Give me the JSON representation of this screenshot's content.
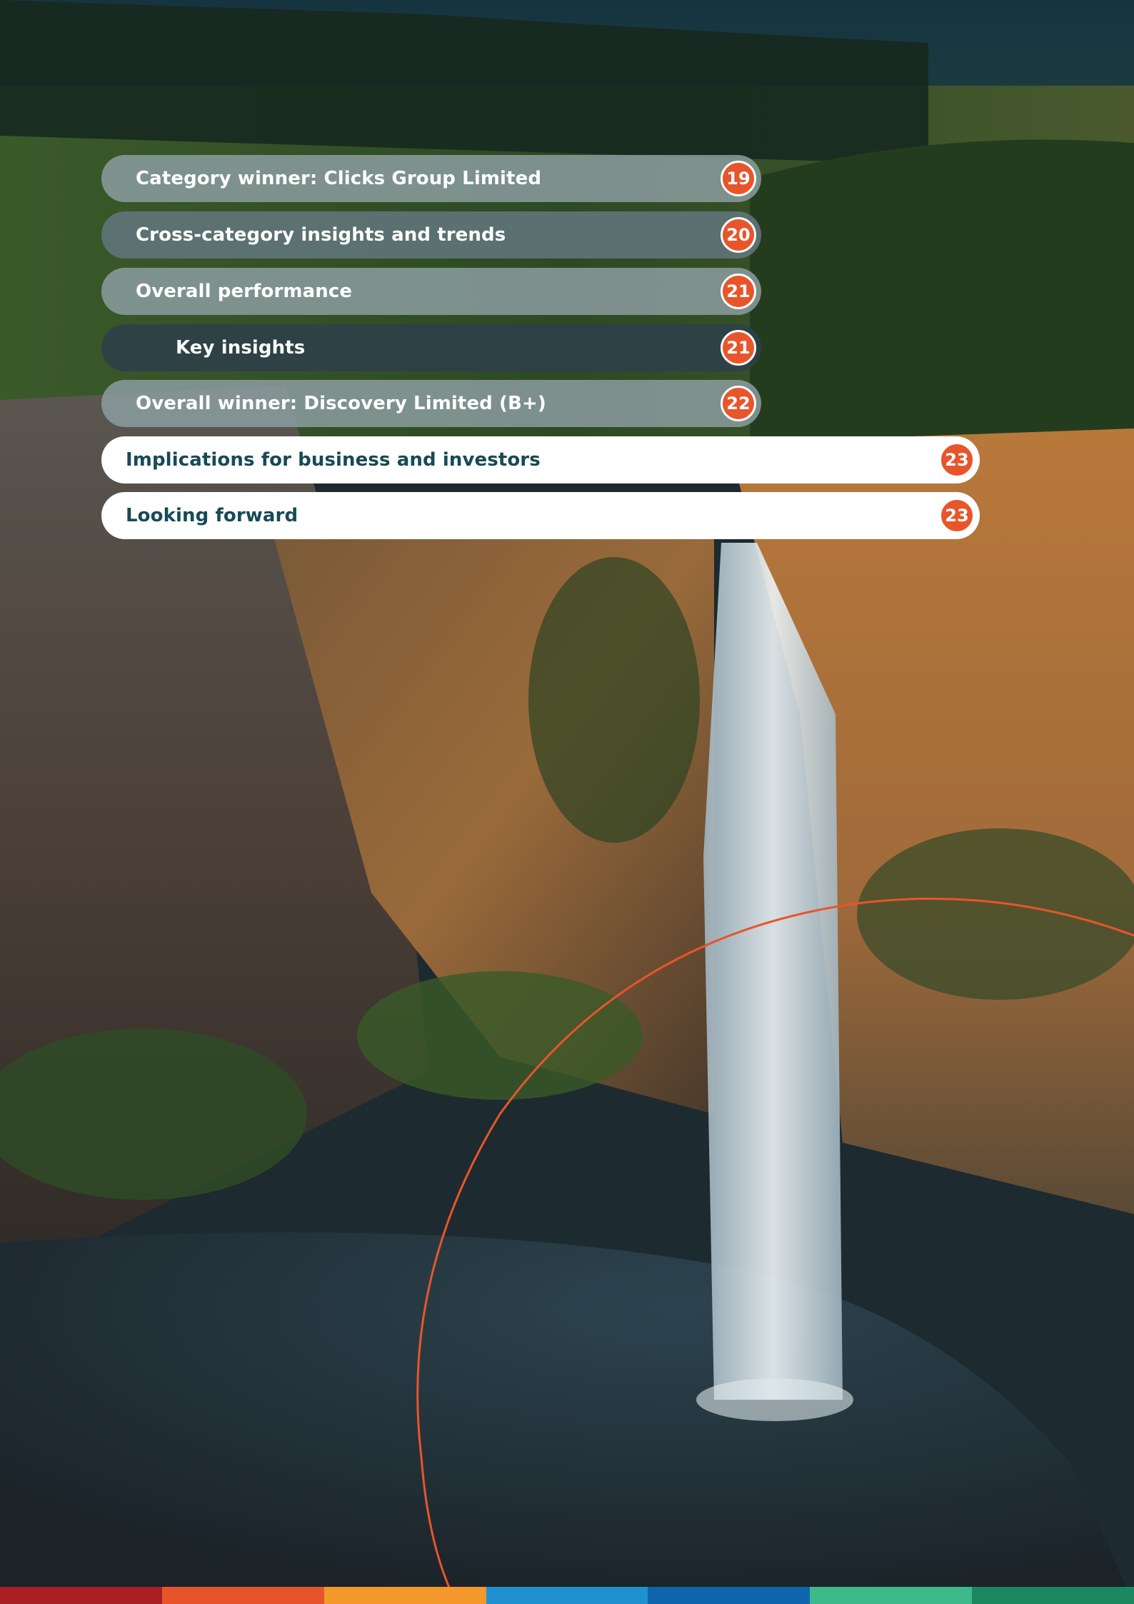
{
  "toc": {
    "entries": [
      {
        "label": "Category winner: Clicks Group Limited",
        "page": "19",
        "level": "sub"
      },
      {
        "label": "Cross-category insights and trends",
        "page": "20",
        "level": "sub"
      },
      {
        "label": "Overall performance",
        "page": "21",
        "level": "sub"
      },
      {
        "label": "Key insights",
        "page": "21",
        "level": "subsub"
      },
      {
        "label": "Overall winner: Discovery Limited (B+)",
        "page": "22",
        "level": "sub"
      },
      {
        "label": "Implications for business and investors",
        "page": "23",
        "level": "main"
      },
      {
        "label": "Looking forward",
        "page": "23",
        "level": "main"
      }
    ]
  },
  "colors": {
    "accent_orange": "#e8552a",
    "heading_teal": "#174a55",
    "stripe": [
      "#a81e22",
      "#e8542a",
      "#f4982c",
      "#1f91d0",
      "#0e65ad",
      "#3db88b",
      "#1b8760"
    ]
  },
  "background_image": "waterfall-canyon-photo"
}
